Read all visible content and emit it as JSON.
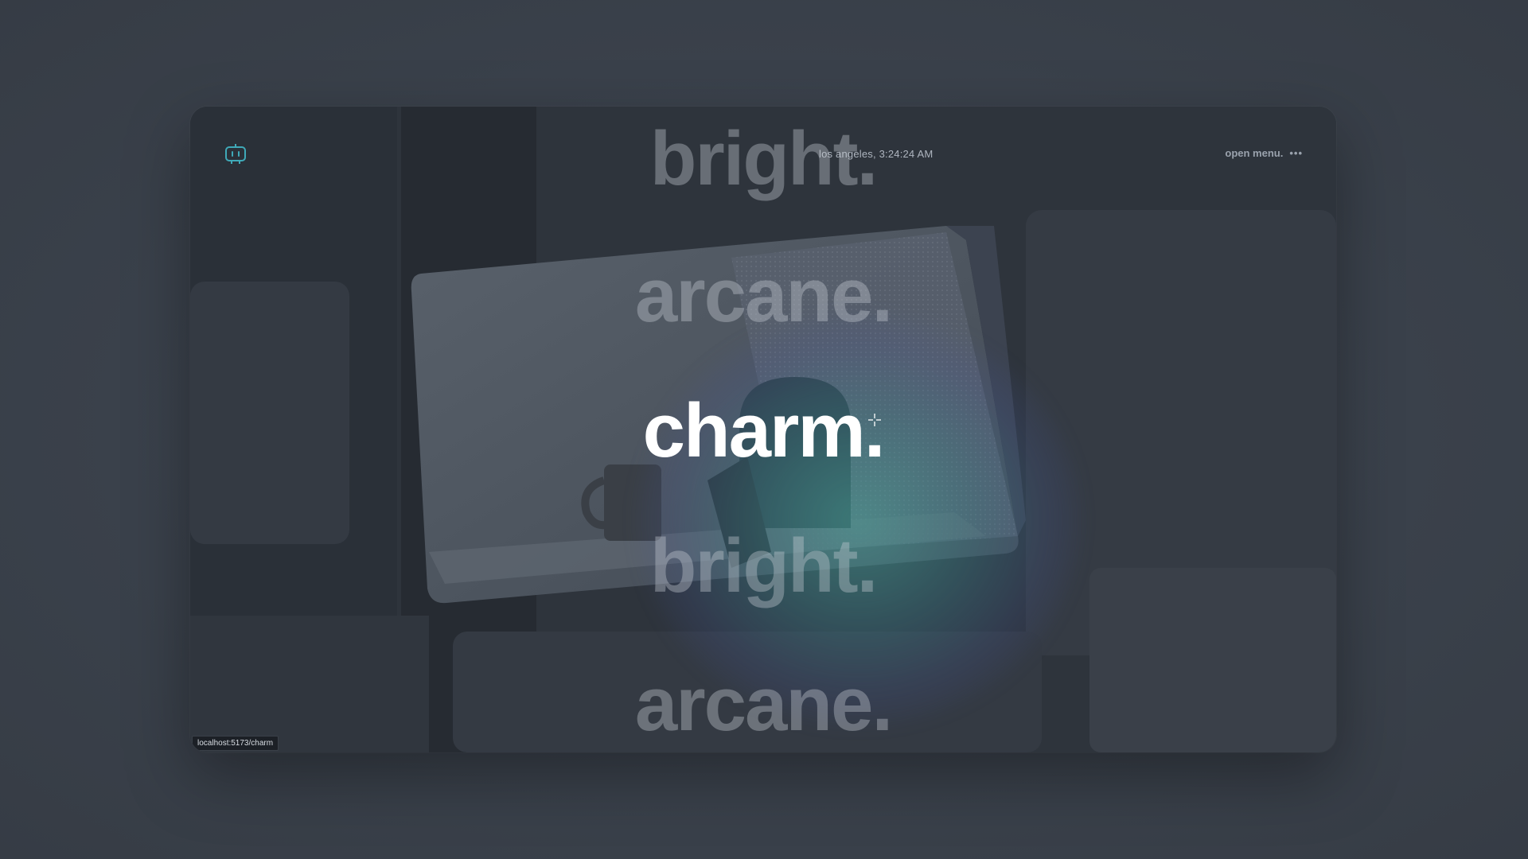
{
  "header": {
    "logo_icon": "robot-face-icon",
    "clock": "los angeles, 3:24:24 AM",
    "menu_label": "open menu.",
    "menu_icon": "ellipsis-icon"
  },
  "words": [
    {
      "label": "bright.",
      "state": "dim"
    },
    {
      "label": "arcane.",
      "state": "dim"
    },
    {
      "label": "charm.",
      "state": "active"
    },
    {
      "label": "bright.",
      "state": "dim"
    },
    {
      "label": "arcane.",
      "state": "dim"
    }
  ],
  "status_bar": {
    "url": "localhost:5173/charm"
  },
  "colors": {
    "accent": "#3fa9b8",
    "glow": "#48aaa0",
    "active_text": "#ffffff",
    "dim_text": "#c8ced6"
  }
}
